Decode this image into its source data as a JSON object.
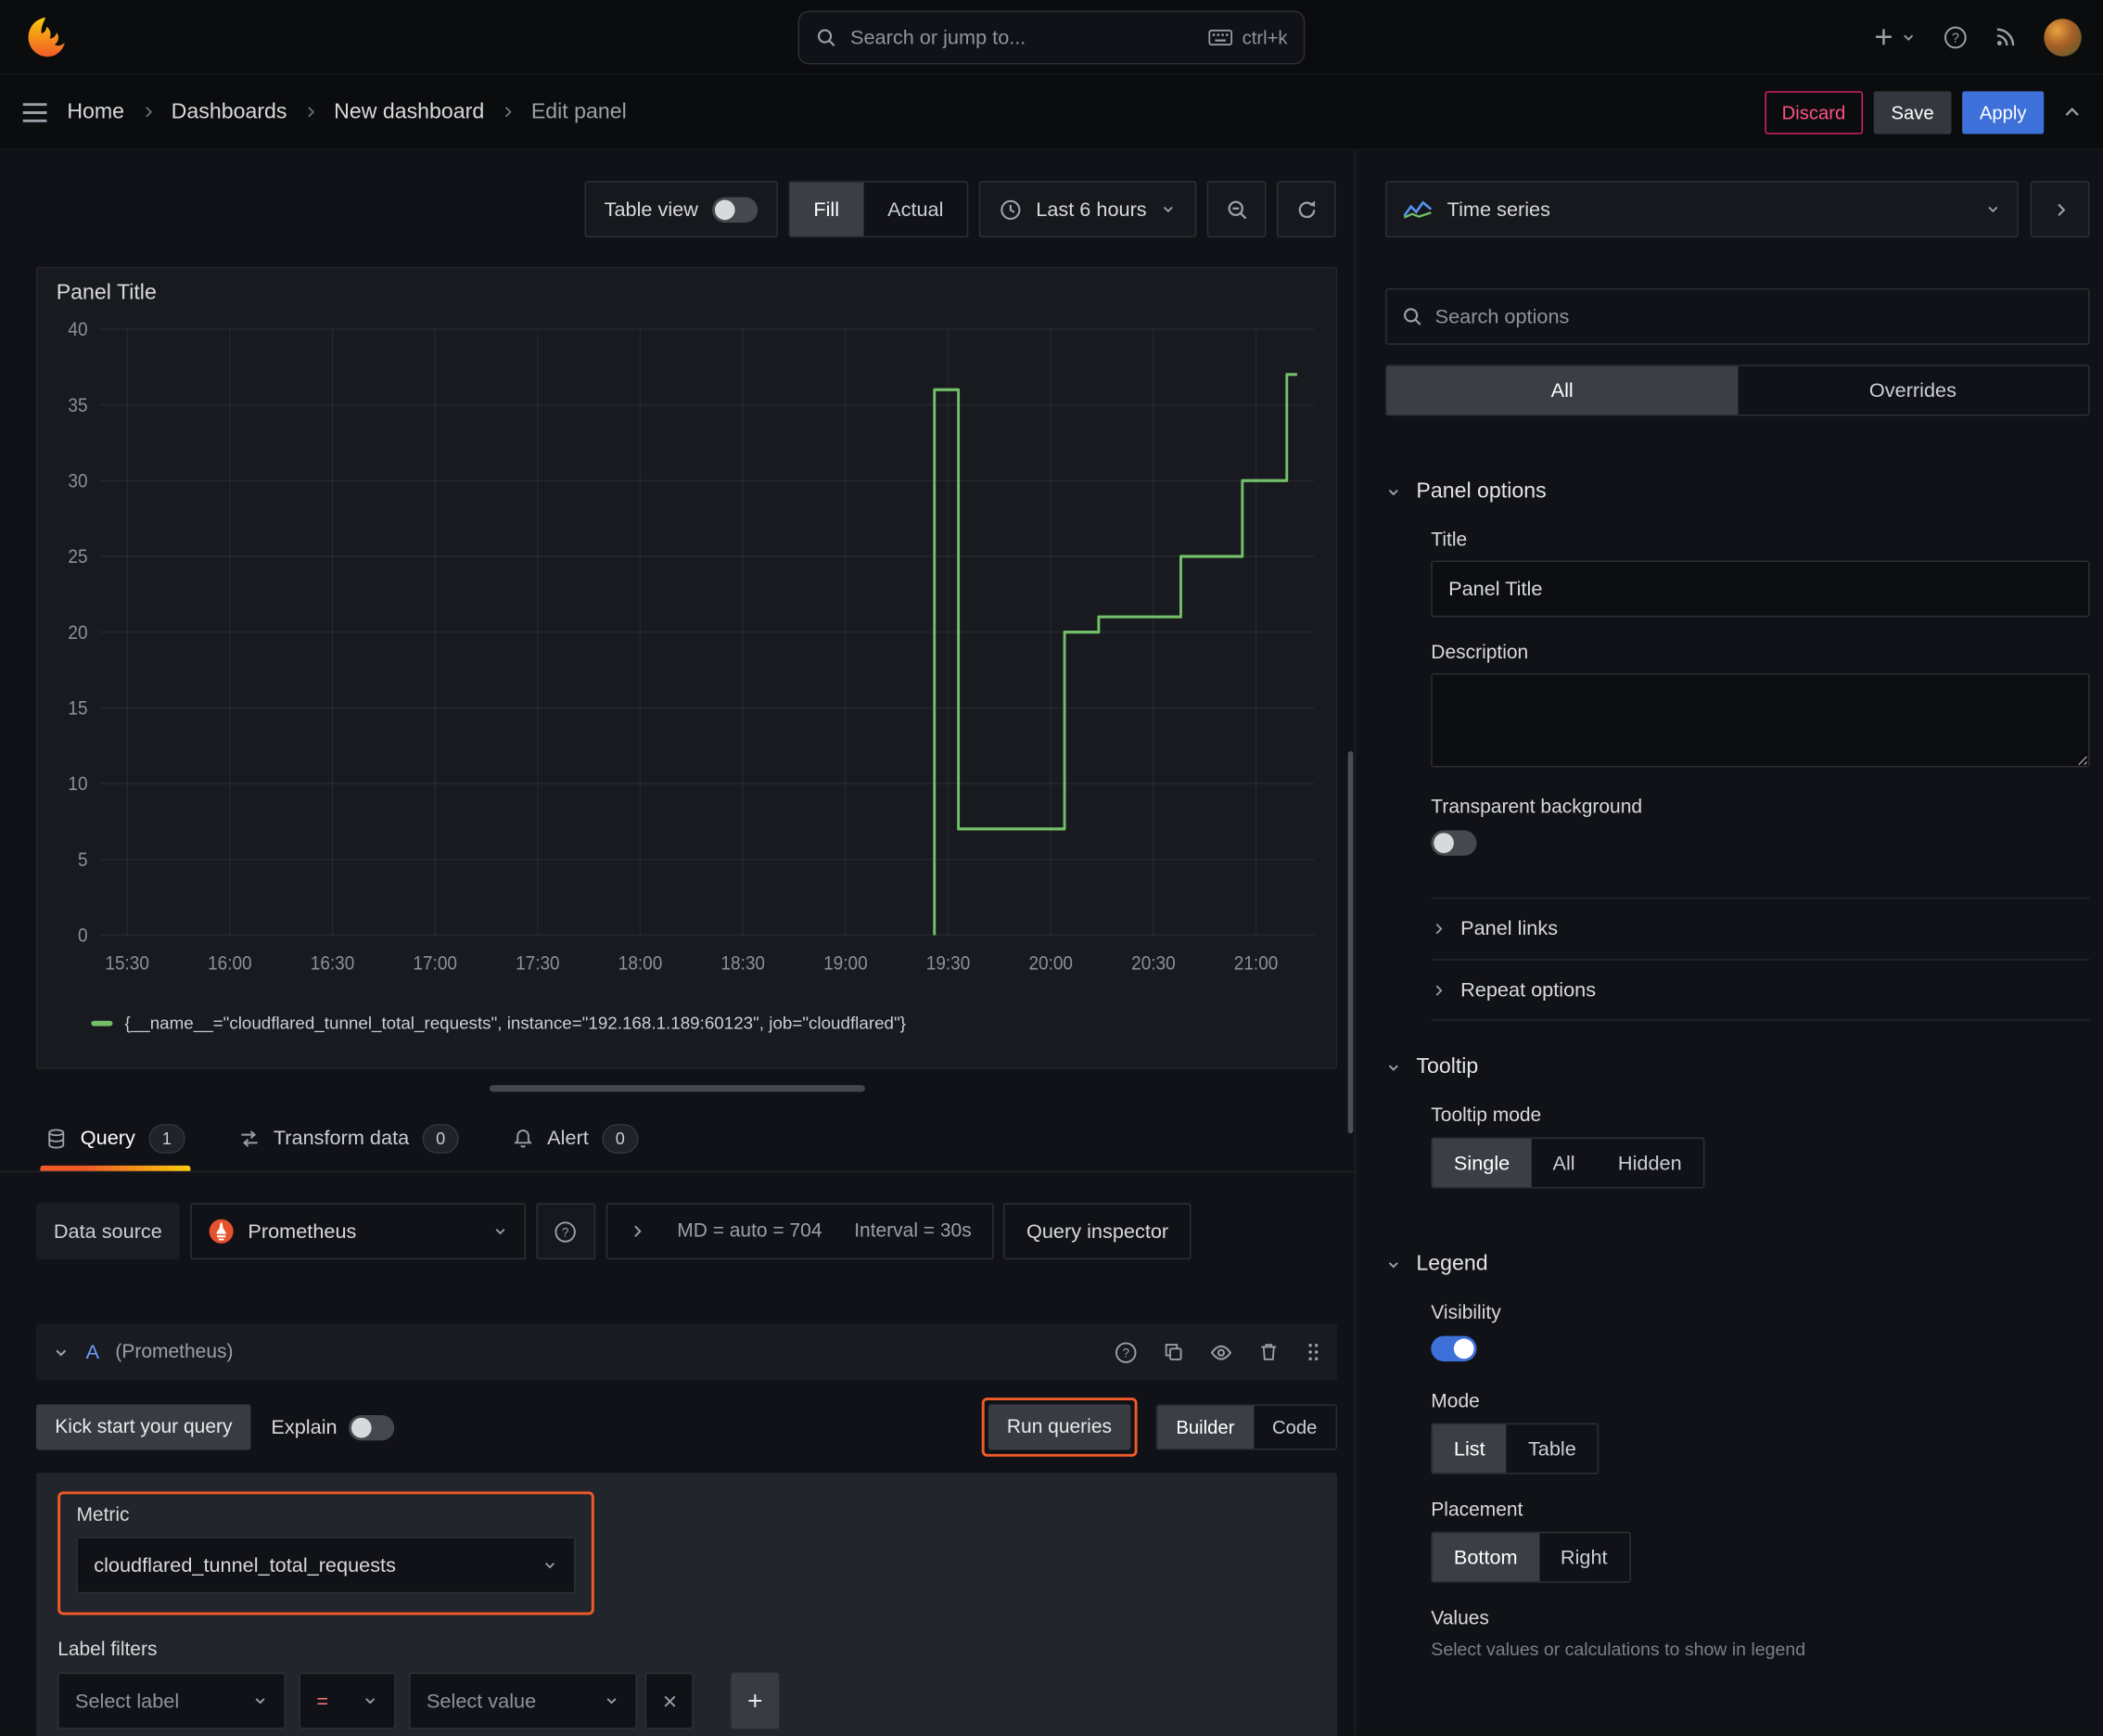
{
  "colors": {
    "accent_blue": "#3d71d9",
    "highlight_orange": "#f05a28",
    "series_green": "#73bf69",
    "danger_red": "#ff5286"
  },
  "topnav": {
    "search_placeholder": "Search or jump to...",
    "search_shortcut": "ctrl+k"
  },
  "breadcrumb": {
    "items": [
      "Home",
      "Dashboards",
      "New dashboard",
      "Edit panel"
    ]
  },
  "header_actions": {
    "discard": "Discard",
    "save": "Save",
    "apply": "Apply"
  },
  "toolbar": {
    "table_view_label": "Table view",
    "fill_label": "Fill",
    "actual_label": "Actual",
    "time_range_label": "Last 6 hours"
  },
  "panel": {
    "title": "Panel Title"
  },
  "chart_data": {
    "type": "line",
    "title": "Panel Title",
    "x_ticks": [
      "15:30",
      "16:00",
      "16:30",
      "17:00",
      "17:30",
      "18:00",
      "18:30",
      "19:00",
      "19:30",
      "20:00",
      "20:30",
      "21:00"
    ],
    "y_ticks": [
      0,
      5,
      10,
      15,
      20,
      25,
      30,
      35,
      40
    ],
    "ylim": [
      0,
      40
    ],
    "x_domain_minutes": [
      -8,
      347
    ],
    "grid": true,
    "legend_position": "bottom",
    "series": [
      {
        "name": "{__name__=\"cloudflared_tunnel_total_requests\", instance=\"192.168.1.189:60123\", job=\"cloudflared\"}",
        "color": "#73bf69",
        "points": [
          [
            "19:26",
            0
          ],
          [
            "19:26",
            36
          ],
          [
            "19:33",
            36
          ],
          [
            "19:33",
            7
          ],
          [
            "20:04",
            7
          ],
          [
            "20:04",
            20
          ],
          [
            "20:14",
            20
          ],
          [
            "20:14",
            21
          ],
          [
            "20:38",
            21
          ],
          [
            "20:38",
            25
          ],
          [
            "20:56",
            25
          ],
          [
            "20:56",
            30
          ],
          [
            "21:09",
            30
          ],
          [
            "21:09",
            37
          ],
          [
            "21:12",
            37
          ]
        ]
      }
    ]
  },
  "tabs": {
    "query": "Query",
    "query_count": "1",
    "transform": "Transform data",
    "transform_count": "0",
    "alert": "Alert",
    "alert_count": "0"
  },
  "query_editor": {
    "datasource_label": "Data source",
    "datasource_value": "Prometheus",
    "max_data_points": "MD = auto = 704",
    "interval": "Interval = 30s",
    "query_inspector": "Query inspector",
    "ref_id": "A",
    "ref_datasource": "(Prometheus)",
    "kick_start": "Kick start your query",
    "explain": "Explain",
    "run_queries": "Run queries",
    "builder": "Builder",
    "code": "Code",
    "metric_label": "Metric",
    "metric_value": "cloudflared_tunnel_total_requests",
    "label_filters_label": "Label filters",
    "select_label_placeholder": "Select label",
    "operator": "=",
    "select_value_placeholder": "Select value"
  },
  "options_pane": {
    "visualization": "Time series",
    "search_placeholder": "Search options",
    "tab_all": "All",
    "tab_overrides": "Overrides",
    "panel_options": {
      "title": "Panel options",
      "title_label": "Title",
      "title_value": "Panel Title",
      "description_label": "Description",
      "transparent_label": "Transparent background",
      "panel_links": "Panel links",
      "repeat_options": "Repeat options"
    },
    "tooltip": {
      "title": "Tooltip",
      "mode_label": "Tooltip mode",
      "single": "Single",
      "all": "All",
      "hidden": "Hidden"
    },
    "legend": {
      "title": "Legend",
      "visibility_label": "Visibility",
      "mode_label": "Mode",
      "list": "List",
      "table": "Table",
      "placement_label": "Placement",
      "bottom": "Bottom",
      "right": "Right",
      "values_label": "Values",
      "values_hint": "Select values or calculations to show in legend"
    }
  }
}
